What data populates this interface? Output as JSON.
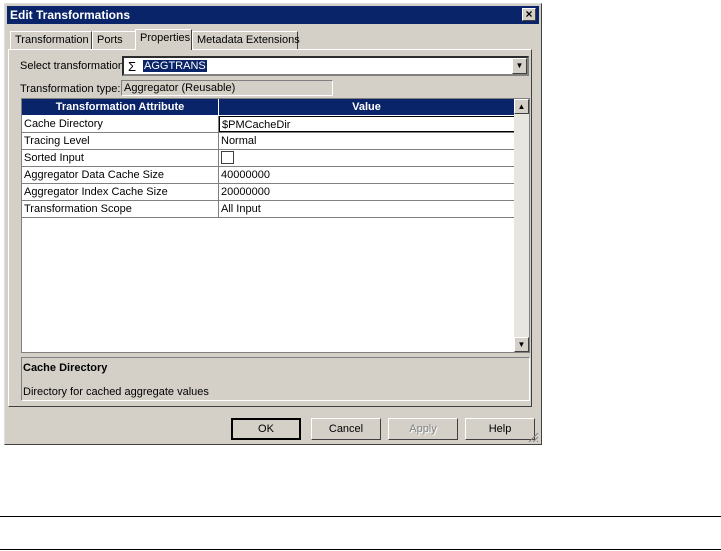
{
  "window": {
    "title": "Edit Transformations"
  },
  "tabs": [
    {
      "label": "Transformation"
    },
    {
      "label": "Ports"
    },
    {
      "label": "Properties"
    },
    {
      "label": "Metadata Extensions"
    }
  ],
  "select_transformation": {
    "label": "Select transformation:",
    "value": "AGGTRANS"
  },
  "transformation_type": {
    "label": "Transformation type:",
    "value": "Aggregator (Reusable)"
  },
  "grid": {
    "headers": [
      "Transformation Attribute",
      "Value"
    ],
    "rows": [
      {
        "attr": "Cache Directory",
        "value": "$PMCacheDir"
      },
      {
        "attr": "Tracing Level",
        "value": "Normal"
      },
      {
        "attr": "Sorted Input",
        "value": ""
      },
      {
        "attr": "Aggregator Data Cache Size",
        "value": "40000000"
      },
      {
        "attr": "Aggregator Index Cache Size",
        "value": "20000000"
      },
      {
        "attr": "Transformation Scope",
        "value": "All Input"
      }
    ]
  },
  "description": {
    "title": "Cache Directory",
    "text": "Directory for cached aggregate values"
  },
  "buttons": {
    "ok": "OK",
    "cancel": "Cancel",
    "apply": "Apply",
    "help": "Help"
  }
}
